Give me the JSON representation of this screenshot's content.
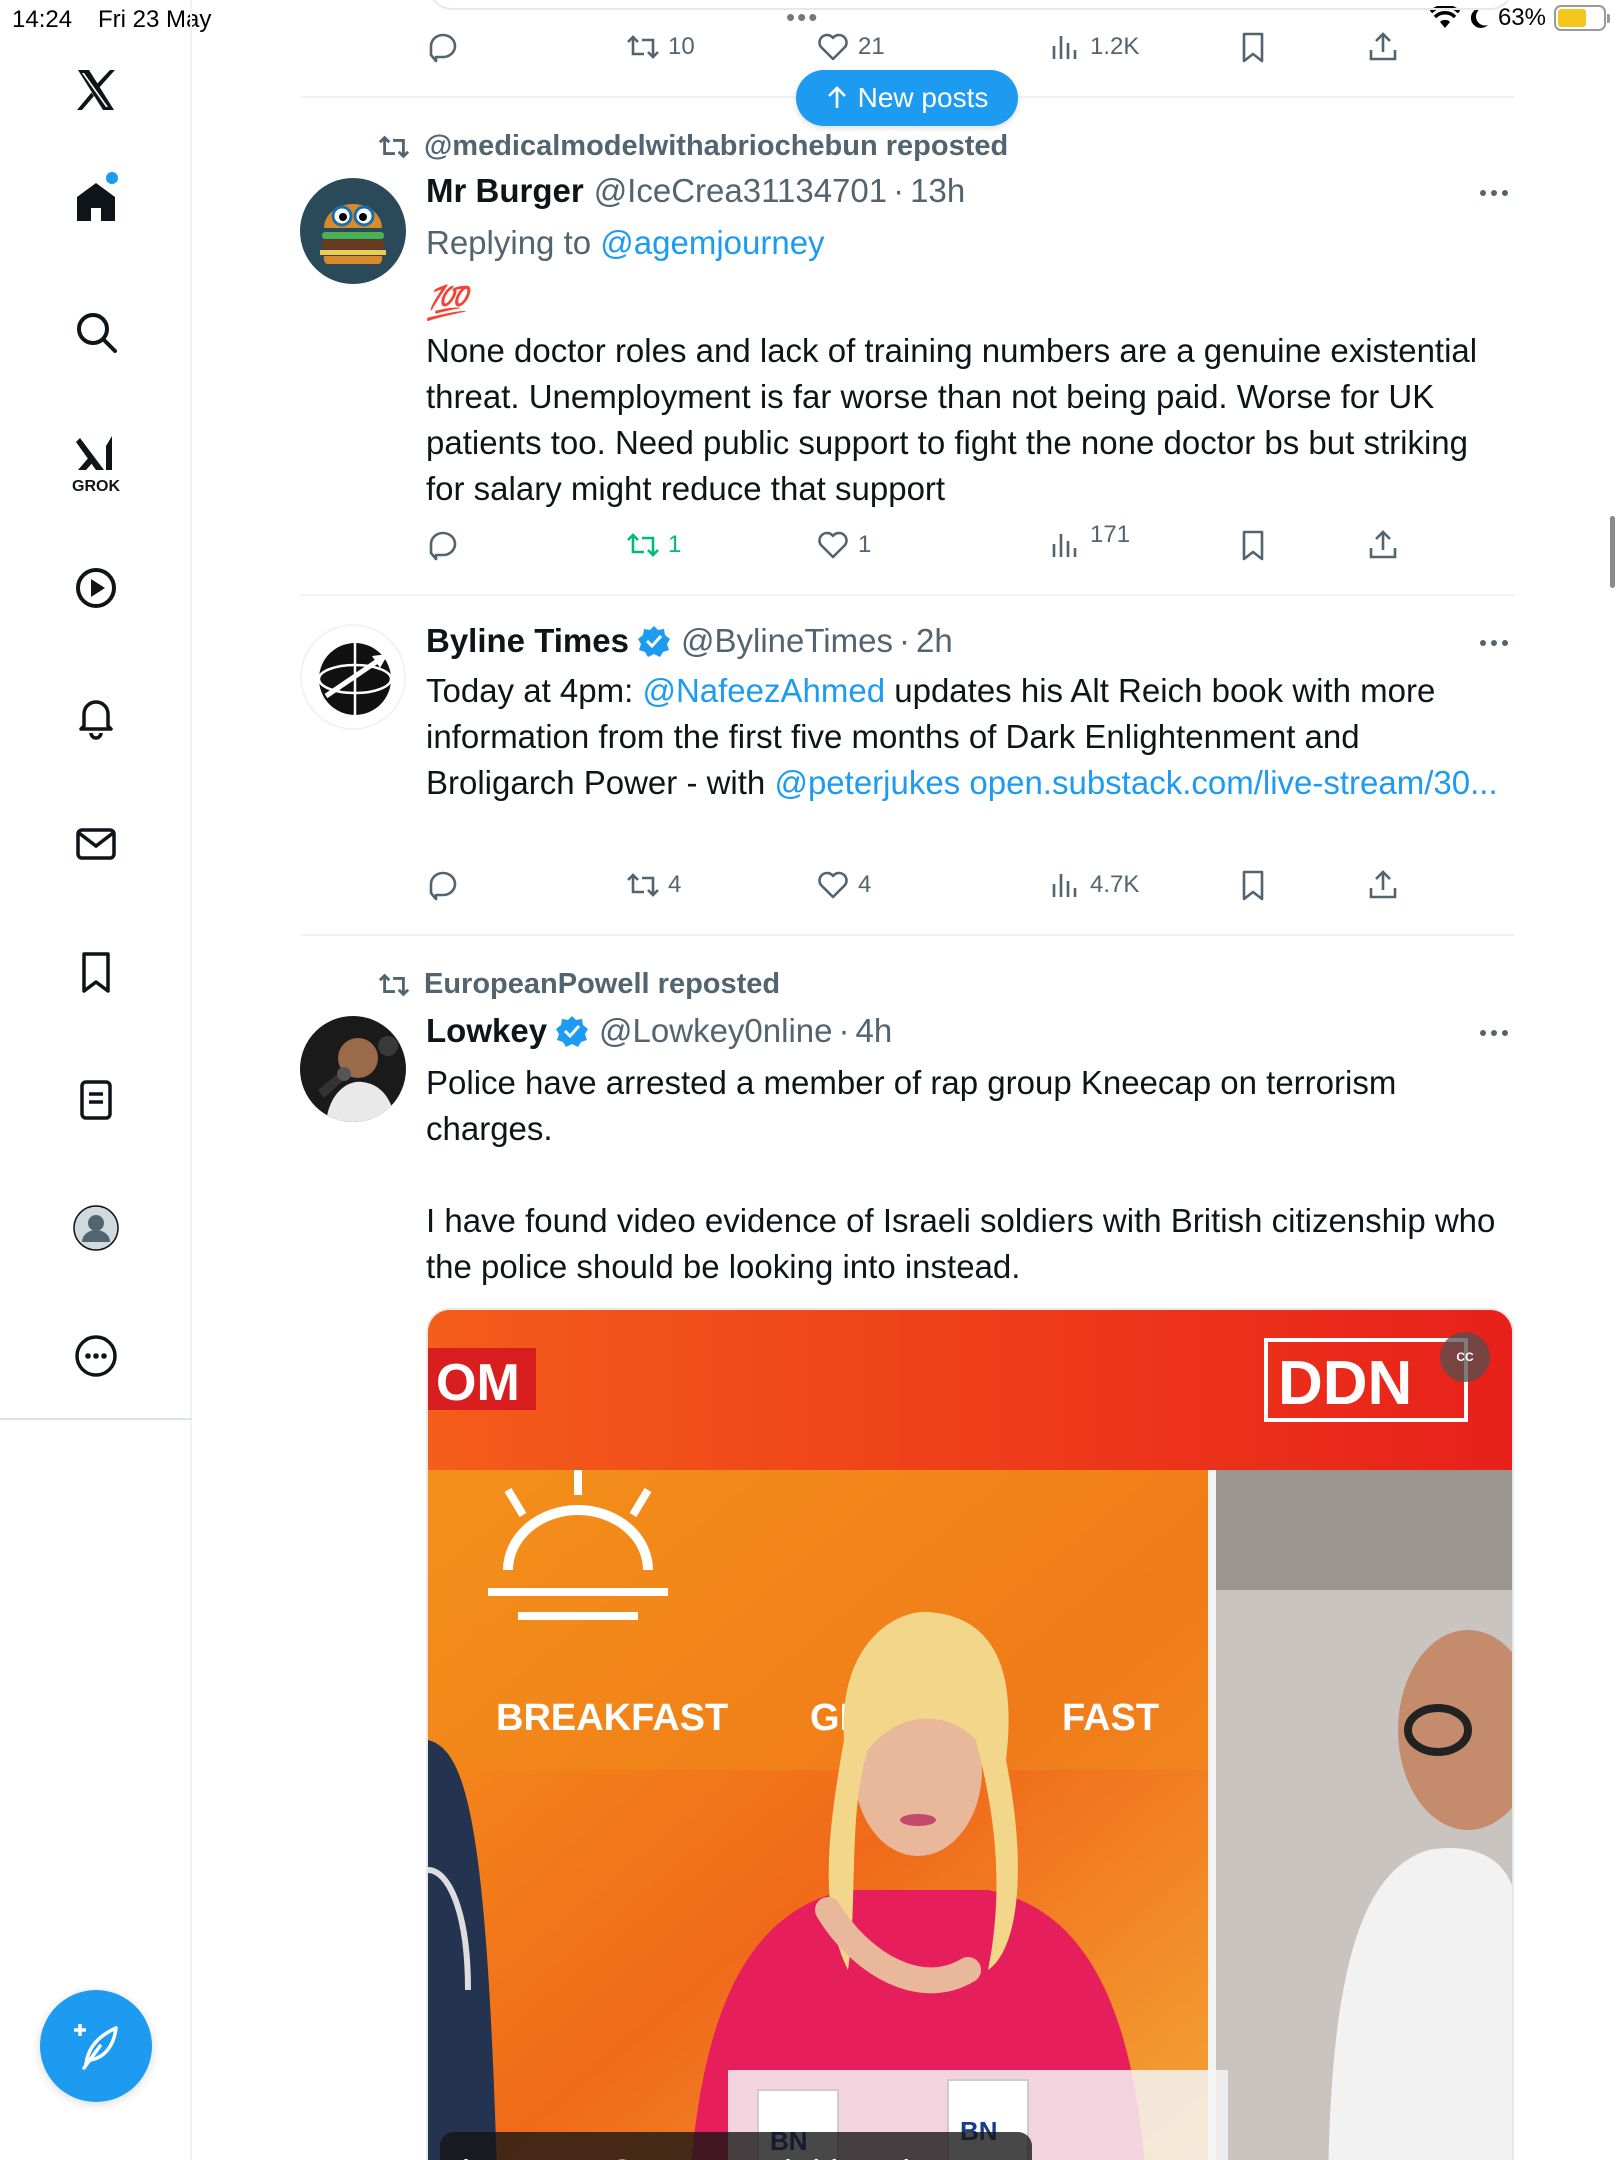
{
  "status_bar": {
    "time": "14:24",
    "date": "Fri 23 May",
    "battery": "63%",
    "battery_level": 0.63
  },
  "sidebar": {
    "items": [
      {
        "icon": "x-logo-icon"
      },
      {
        "icon": "home-icon",
        "active": true
      },
      {
        "icon": "search-icon"
      },
      {
        "icon": "grok-icon",
        "label": "GROK"
      },
      {
        "icon": "video-icon"
      },
      {
        "icon": "notifications-icon"
      },
      {
        "icon": "messages-icon"
      },
      {
        "icon": "bookmarks-icon"
      },
      {
        "icon": "lists-icon"
      },
      {
        "icon": "profile-icon"
      },
      {
        "icon": "more-icon"
      }
    ],
    "compose": {
      "icon": "compose-icon"
    }
  },
  "feed": {
    "new_posts_label": "New posts",
    "top_post_actions": {
      "replies": "",
      "reposts": "10",
      "likes": "21",
      "views": "1.2K"
    },
    "posts": [
      {
        "reposted_by": "@medicalmodelwithabriochebun reposted",
        "name": "Mr Burger",
        "handle": "@IceCrea31134701",
        "time": "13h",
        "replying_prefix": "Replying to ",
        "replying_to": "@agemjourney",
        "emoji": "💯",
        "text": "None doctor roles and lack of training numbers are a genuine existential threat. Unemployment is far worse than not being paid. Worse for UK patients too.  Need public support to fight the none doctor bs but striking for salary might reduce that support",
        "actions": {
          "replies": "",
          "reposts": "1",
          "likes": "1",
          "views": "171"
        }
      },
      {
        "name": "Byline Times",
        "handle": "@BylineTimes",
        "time": "2h",
        "verified": true,
        "text_prefix": "Today at 4pm: ",
        "mention_1": "@NafeezAhmed",
        "text_mid": " updates his Alt Reich book with more information from the first five months of Dark Enlightenment and Broligarch Power - with ",
        "mention_2": "@peterjukes",
        "link": "open.substack.com/live-stream/30...",
        "actions": {
          "replies": "",
          "reposts": "4",
          "likes": "4",
          "views": "4.7K"
        }
      },
      {
        "reposted_by": "EuropeanPowell reposted",
        "name": "Lowkey",
        "handle": "@Lowkey0nline",
        "time": "4h",
        "verified": true,
        "text": "Police have arrested a member of rap group Kneecap on terrorism charges.\n\nI have found video evidence of Israeli soldiers with British citizenship who the police should be looking into instead.",
        "media": {
          "caption": "kneecap Controversial band",
          "cc_label": "CC",
          "overlay_left": "OM",
          "overlay_right": "DDN",
          "banner_1": "BREAKFAST",
          "banner_2": "GE",
          "banner_3": "FAST",
          "mug_label": "BN"
        }
      }
    ]
  },
  "colors": {
    "accent": "#1d9bf0",
    "repost_green": "#00ba7c",
    "muted": "#536471",
    "text": "#0f1419"
  }
}
